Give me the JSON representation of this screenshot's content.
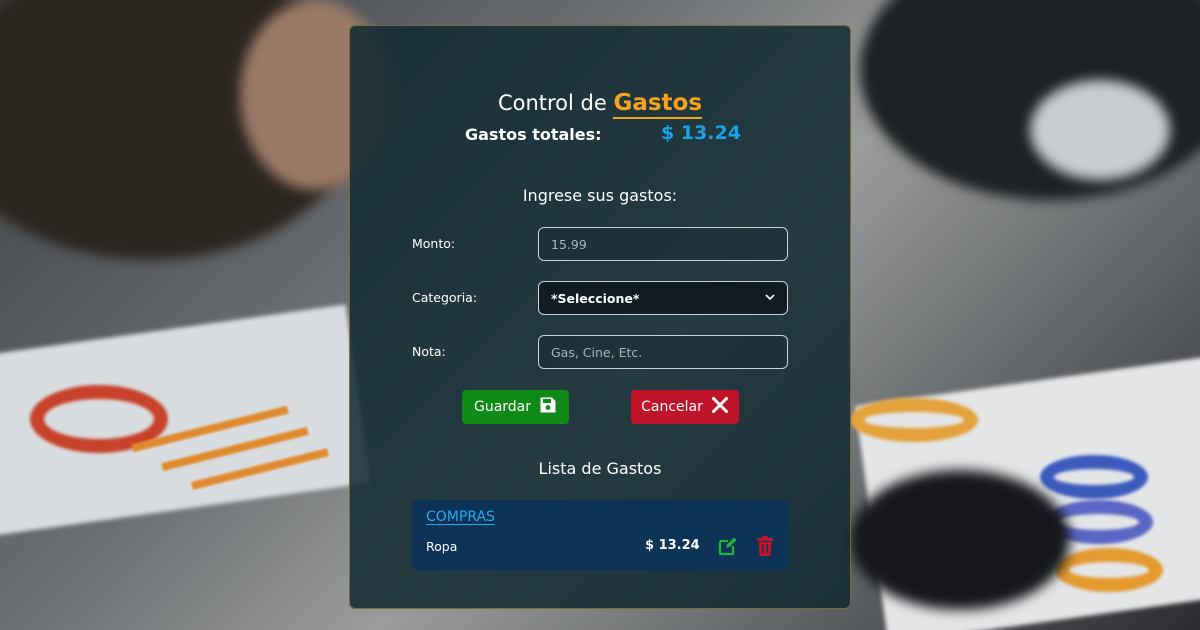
{
  "app": {
    "title_prefix": "Control de",
    "title_accent": "Gastos"
  },
  "summary": {
    "total_label": "Gastos totales:",
    "total_value": "$ 13.24"
  },
  "form": {
    "heading": "Ingrese sus gastos:",
    "amount_label": "Monto:",
    "amount_placeholder": "15.99",
    "category_label": "Categoria:",
    "category_selected": "*Seleccione*",
    "note_label": "Nota:",
    "note_placeholder": "Gas, Cine, Etc.",
    "save_label": "Guardar",
    "cancel_label": "Cancelar"
  },
  "list": {
    "heading": "Lista de Gastos",
    "groups": [
      {
        "title": "COMPRAS",
        "items": [
          {
            "name": "Ropa",
            "amount": "$ 13.24"
          }
        ]
      }
    ]
  },
  "colors": {
    "accent": "#f4a31f",
    "total": "#1aa3e8",
    "save": "#0f8a16",
    "cancel": "#c0142a",
    "edit_icon": "#22b33a",
    "delete_icon": "#c0142a"
  },
  "icons": {
    "save": "floppy-disk-icon",
    "cancel": "close-icon",
    "edit": "edit-icon",
    "delete": "trash-icon",
    "select": "chevron-down-icon"
  }
}
